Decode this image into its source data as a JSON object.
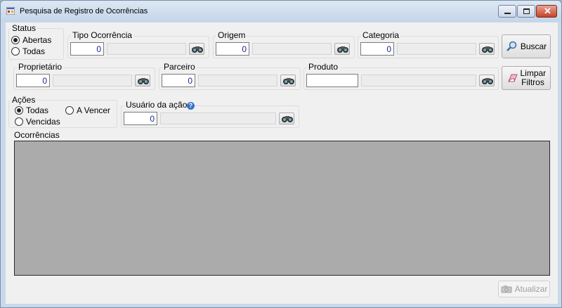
{
  "window": {
    "title": "Pesquisa de Registro de Ocorrências"
  },
  "status": {
    "label": "Status",
    "options": [
      "Abertas",
      "Todas"
    ],
    "selected": "Abertas"
  },
  "tipo_ocorrencia": {
    "label": "Tipo Ocorrência",
    "code": "0",
    "description": ""
  },
  "origem": {
    "label": "Origem",
    "code": "0",
    "description": ""
  },
  "categoria": {
    "label": "Categoria",
    "code": "0",
    "description": ""
  },
  "proprietario": {
    "label": "Proprietário",
    "code": "0",
    "description": ""
  },
  "parceiro": {
    "label": "Parceiro",
    "code": "0",
    "description": ""
  },
  "produto": {
    "label": "Produto",
    "code": "",
    "description": ""
  },
  "acoes": {
    "label": "Ações",
    "options": [
      "Todas",
      "A Vencer",
      "Vencidas"
    ],
    "selected": "Todas"
  },
  "usuario_acao": {
    "label": "Usuário da ação",
    "code": "0",
    "description": ""
  },
  "ocorrencias": {
    "label": "Ocorrências"
  },
  "buttons": {
    "buscar": "Buscar",
    "limpar_filtros": "Limpar Filtros",
    "atualizar": "Atualizar"
  },
  "icons": {
    "search": "binoculars-icon",
    "magnifier": "magnifier-icon",
    "eraser": "eraser-icon",
    "help": "help-icon",
    "refresh": "refresh-icon"
  }
}
